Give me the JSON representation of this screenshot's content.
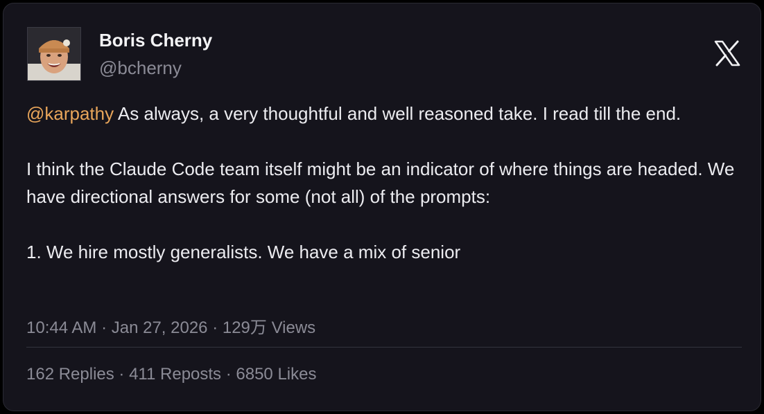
{
  "author": {
    "name": "Boris Cherny",
    "handle": "@bcherny",
    "avatar_icon": "avatar-photo"
  },
  "brand": {
    "logo_icon": "x-logo-icon"
  },
  "tweet": {
    "mention": "@karpathy",
    "line1_rest": " As always, a very thoughtful and well reasoned take. I read till the end.",
    "paragraph2": "I think the Claude Code team itself might be an indicator of where things are headed. We have directional answers for some (not all) of the prompts:",
    "paragraph3": "1. We hire mostly generalists. We have a mix of senior"
  },
  "meta": {
    "time": "10:44 AM",
    "date": "Jan 27, 2026",
    "views": "129万 Views",
    "separator": " · "
  },
  "stats": {
    "replies": "162 Replies",
    "reposts": "411 Reposts",
    "likes": "6850 Likes",
    "separator": " · "
  },
  "colors": {
    "background": "#15141c",
    "mention": "#e8a55a",
    "muted": "#8b8b96",
    "text": "#ececf0"
  }
}
